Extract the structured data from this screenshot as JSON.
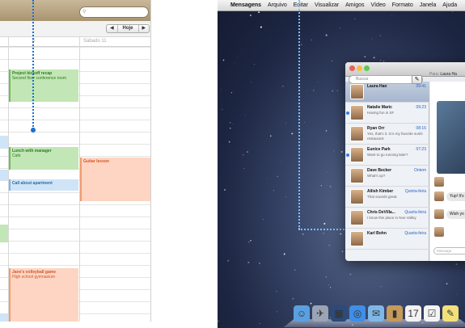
{
  "calendar": {
    "search_placeholder": "",
    "nav": {
      "prev": "◀",
      "today": "Hoje",
      "next": "▶"
    },
    "columns": [
      {
        "label": "",
        "faint": "0"
      },
      {
        "label": "Sábado 11"
      }
    ],
    "events": [
      {
        "title": "Project kickoff recap",
        "sub": "Second floor conference room",
        "color": "green"
      },
      {
        "title": "Lunch with manager",
        "sub": "Cafe",
        "color": "green"
      },
      {
        "title": "Call about apartment",
        "sub": "",
        "color": "blue"
      },
      {
        "title": "Guitar lesson",
        "sub": "",
        "color": "orange"
      },
      {
        "title": "Jane's volleyball game",
        "sub": "High school gymnasium",
        "color": "orange"
      }
    ]
  },
  "mac": {
    "menubar": {
      "apple": "",
      "items": [
        "Mensagens",
        "Arquivo",
        "Editar",
        "Visualizar",
        "Amigos",
        "Vídeo",
        "Formato",
        "Janela",
        "Ajuda"
      ]
    },
    "messages_window": {
      "search_placeholder": "Buscar",
      "compose_icon": "compose-icon",
      "to_label": "Para:",
      "to_value": "Laura Ha",
      "conversations": [
        {
          "name": "Laura Han",
          "time": "09:41",
          "preview": "",
          "selected": true,
          "unread": false
        },
        {
          "name": "Natalie Maric",
          "time": "09:23",
          "preview": "Having fun in SF",
          "selected": false,
          "unread": true
        },
        {
          "name": "Ryan Orr",
          "time": "08:16",
          "preview": "Yes, that's it. It is my favorite sushi restaurant.",
          "selected": false,
          "unread": false
        },
        {
          "name": "Eunice Park",
          "time": "07:23",
          "preview": "Want to go running later?",
          "selected": false,
          "unread": true
        },
        {
          "name": "Dave Becker",
          "time": "Ontem",
          "preview": "What's up?",
          "selected": false,
          "unread": false
        },
        {
          "name": "Ailish Kimber",
          "time": "Quinta-feira",
          "preview": "That sounds great.",
          "selected": false,
          "unread": false
        },
        {
          "name": "Chris DeVilla...",
          "time": "Quarta-feira",
          "preview": "I know this place in Noe Valley",
          "selected": false,
          "unread": false
        },
        {
          "name": "Karl Bohn",
          "time": "Quarta-feira",
          "preview": "",
          "selected": false,
          "unread": false
        }
      ],
      "chat_bubbles": [
        "Yup! It's",
        "Wish yo"
      ],
      "message_placeholder": "Message"
    },
    "dock_icons": [
      "finder-icon",
      "launchpad-icon",
      "mission-control-icon",
      "safari-icon",
      "mail-icon",
      "contacts-icon",
      "calendar-icon",
      "reminders-icon",
      "notes-icon"
    ]
  }
}
